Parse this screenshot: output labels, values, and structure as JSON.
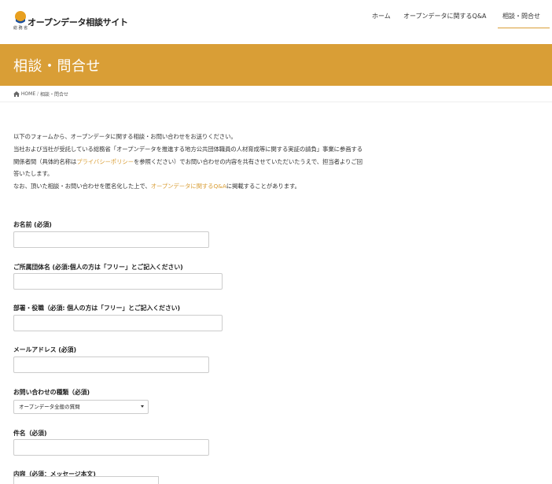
{
  "header": {
    "logo_sub": "総 務 省",
    "site_title": "オープンデータ相談サイト",
    "nav": [
      {
        "label": "ホーム"
      },
      {
        "label": "オープンデータに関するQ&A"
      },
      {
        "label": "相談・問合せ"
      }
    ]
  },
  "page": {
    "title": "相談・問合せ"
  },
  "breadcrumb": {
    "home": "HOME",
    "sep": "/",
    "current": "相談・問合せ"
  },
  "intro": {
    "p1": "以下のフォームから、オープンデータに関する相談・お問い合わせをお送りください。",
    "p2a": "当社および当社が受託している総務省「オープンデータを推進する地方公共団体職員の人材育成等に関する実証の請負」事業に参画する関係者間（具体的名称は",
    "p2_link": "プライバシーポリシー",
    "p2b": "を参照ください）でお問い合わせの内容を共有させていただいたうえで、担当者よりご回答いたします。",
    "p3a": "なお、頂いた相談・お問い合わせを匿名化した上で、",
    "p3_link": "オープンデータに関するQ&A",
    "p3b": "に掲載することがあります。"
  },
  "form": {
    "name_label": "お名前 (必須)",
    "org_label": "ご所属団体名 (必須:個人の方は「フリー」とご記入ください)",
    "dept_label": "部署・役職（必須: 個人の方は「フリー」とご記入ください)",
    "email_label": "メールアドレス (必須)",
    "type_label": "お問い合わせの種類（必須)",
    "type_selected": "オープンデータ全般の質問",
    "subject_label": "件名（必須)",
    "content_label": "内容（必須：メッセージ本文)"
  },
  "colors": {
    "accent": "#d99e36"
  },
  "icons": {
    "home": "home-icon",
    "logo": "logo-mark-icon",
    "caret": "chevron-down-icon"
  }
}
